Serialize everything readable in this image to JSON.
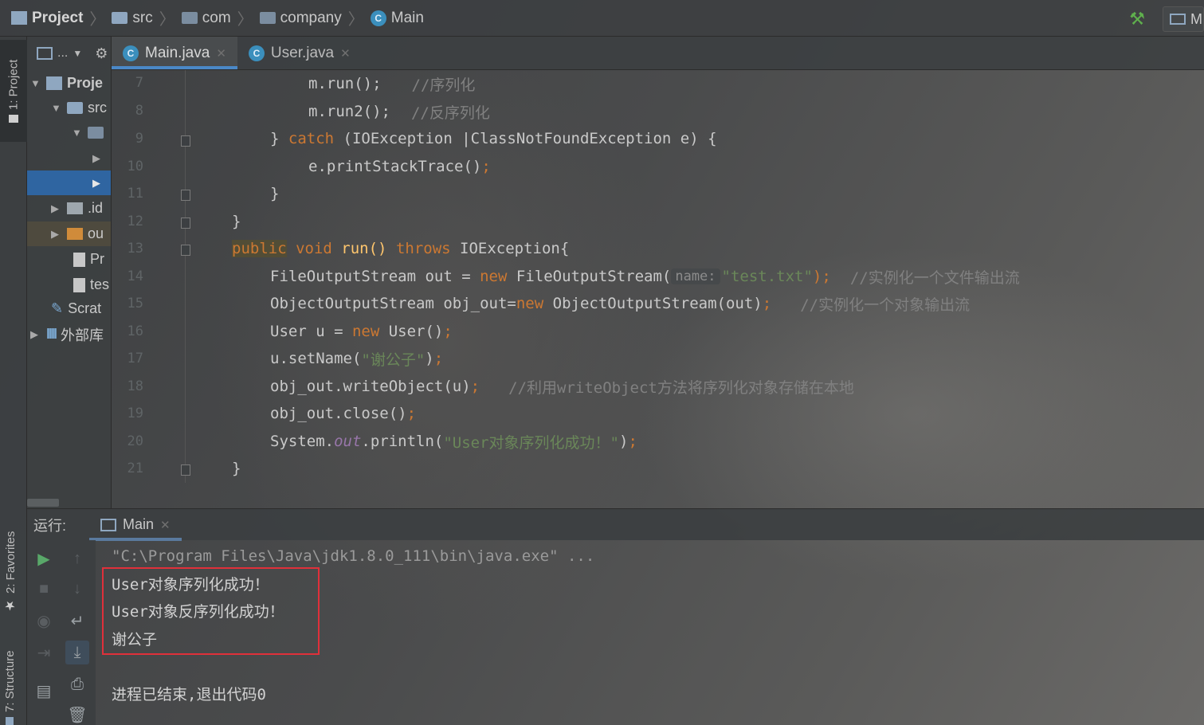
{
  "navbar": {
    "breadcrumbs": [
      {
        "label": "Project",
        "icon": "project-icon"
      },
      {
        "label": "src",
        "icon": "folder-icon"
      },
      {
        "label": "com",
        "icon": "package-icon"
      },
      {
        "label": "company",
        "icon": "package-icon"
      },
      {
        "label": "Main",
        "icon": "class-icon"
      }
    ],
    "run_config": "M"
  },
  "left_stripe": {
    "project_tab": "1: Project",
    "favorites_tab": "2: Favorites",
    "structure_tab": "7: Structure"
  },
  "project_panel": {
    "toolbar_label": "...",
    "tree": [
      {
        "label": "Proje",
        "icon": "project-icon"
      },
      {
        "label": "src",
        "icon": "folder-icon"
      },
      {
        "label": "",
        "icon": "package-icon"
      },
      {
        "label": "",
        "icon": "expand-icon"
      },
      {
        "label": "",
        "icon": "expand-icon"
      },
      {
        "label": ".id",
        "icon": "folder-icon"
      },
      {
        "label": "ou",
        "icon": "folder-orange-icon"
      },
      {
        "label": "Pr",
        "icon": "file-icon"
      },
      {
        "label": "tes",
        "icon": "file-icon"
      },
      {
        "label": "Scrat",
        "icon": "scratch-icon"
      },
      {
        "label": "外部库",
        "icon": "library-icon"
      }
    ]
  },
  "editor": {
    "tabs": [
      {
        "label": "Main.java",
        "active": true
      },
      {
        "label": "User.java",
        "active": false
      }
    ],
    "line_numbers": [
      "7",
      "8",
      "9",
      "10",
      "11",
      "12",
      "13",
      "14",
      "15",
      "16",
      "17",
      "18",
      "19",
      "20",
      "21"
    ],
    "code": {
      "l7_a": "m.run();",
      "l7_c": "//序列化",
      "l8_a": "m.run2();",
      "l8_c": "//反序列化",
      "l9_a": "} ",
      "l9_kw": "catch",
      "l9_b": " (IOException |ClassNotFoundException e) {",
      "l10_a": "e.printStackTrace()",
      "l10_semi": ";",
      "l11_a": "}",
      "l12_a": "}",
      "l13_kw1": "public",
      "l13_kw2": "void",
      "l13_name": " run() ",
      "l13_kw3": "throws",
      "l13_b": " IOException{",
      "l14_a": "FileOutputStream out = ",
      "l14_kw": "new",
      "l14_b": " FileOutputStream(",
      "l14_hint": "name:",
      "l14_str": "\"test.txt\"",
      "l14_c": ");",
      "l14_cmt": "//实例化一个文件输出流",
      "l15_a": "ObjectOutputStream obj_out=",
      "l15_kw": "new",
      "l15_b": " ObjectOutputStream(out)",
      "l15_semi": ";",
      "l15_cmt": "//实例化一个对象输出流",
      "l16_a": "User u = ",
      "l16_kw": "new",
      "l16_b": " User()",
      "l16_semi": ";",
      "l17_a": "u.setName(",
      "l17_str": "\"谢公子\"",
      "l17_b": ")",
      "l17_semi": ";",
      "l18_a": "obj_out.writeObject(u)",
      "l18_semi": ";",
      "l18_cmt": "//利用writeObject方法将序列化对象存储在本地",
      "l19_a": "obj_out.close()",
      "l19_semi": ";",
      "l20_a": "System.",
      "l20_fld": "out",
      "l20_b": ".println(",
      "l20_str": "\"User对象序列化成功！\"",
      "l20_c": ")",
      "l20_semi": ";",
      "l21_a": "}"
    }
  },
  "run_panel": {
    "label": "运行:",
    "tab": "Main",
    "console": {
      "cmd": "\"C:\\Program Files\\Java\\jdk1.8.0_111\\bin\\java.exe\" ...",
      "out1": "User对象序列化成功！",
      "out2": "User对象反序列化成功！",
      "out3": "谢公子",
      "exit": "进程已结束,退出代码0"
    }
  },
  "colors": {
    "keyword": "#cc7832",
    "string": "#6a8759",
    "comment": "#808080",
    "highlight_box": "#e0303a",
    "selection": "#2f65a1"
  }
}
